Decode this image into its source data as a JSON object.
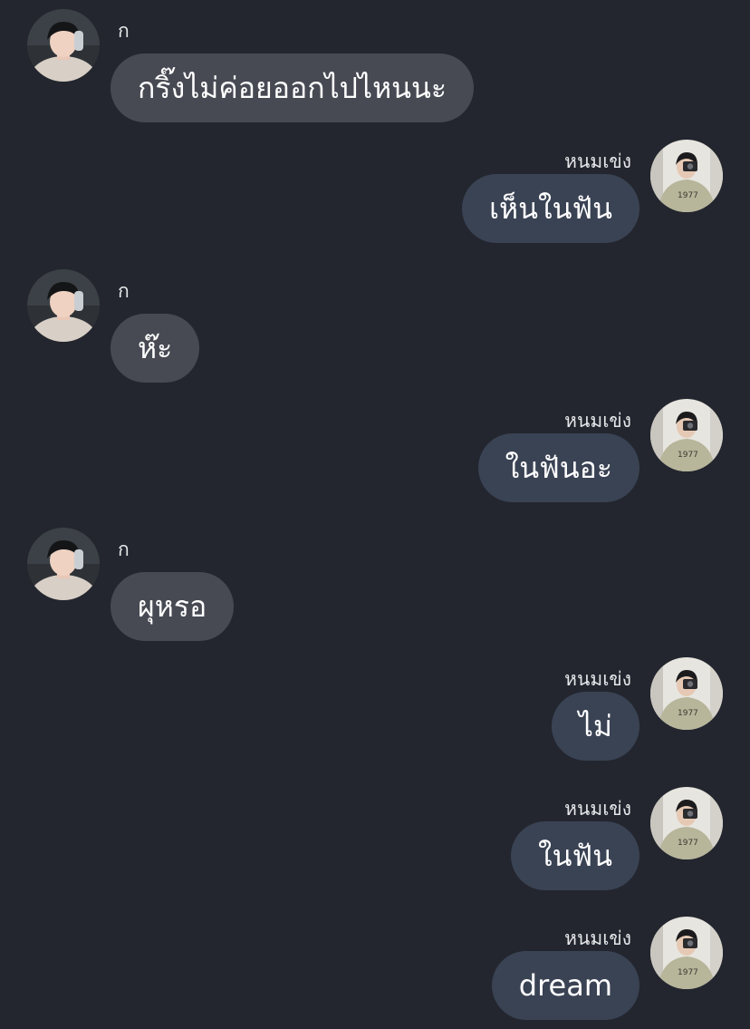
{
  "chat": {
    "messages": [
      {
        "direction": "in",
        "sender": "ก",
        "text": "กริ๊งไม่ค่อยออกไปไหนนะ"
      },
      {
        "direction": "out",
        "sender": "หนมเข่ง",
        "text": "เห็นในฟัน"
      },
      {
        "direction": "in",
        "sender": "ก",
        "text": "ห๊ะ"
      },
      {
        "direction": "out",
        "sender": "หนมเข่ง",
        "text": "ในฟันอะ"
      },
      {
        "direction": "in",
        "sender": "ก",
        "text": "ผุหรอ"
      },
      {
        "direction": "out",
        "sender": "หนมเข่ง",
        "text": "ไม่"
      },
      {
        "direction": "out",
        "sender": "หนมเข่ง",
        "text": "ในฟัน"
      },
      {
        "direction": "out",
        "sender": "หนมเข่ง",
        "text": "dream"
      }
    ]
  },
  "colors": {
    "background": "#23262e",
    "incoming_bubble": "#474a53",
    "outgoing_bubble": "#3a4354",
    "text": "#ffffff"
  }
}
